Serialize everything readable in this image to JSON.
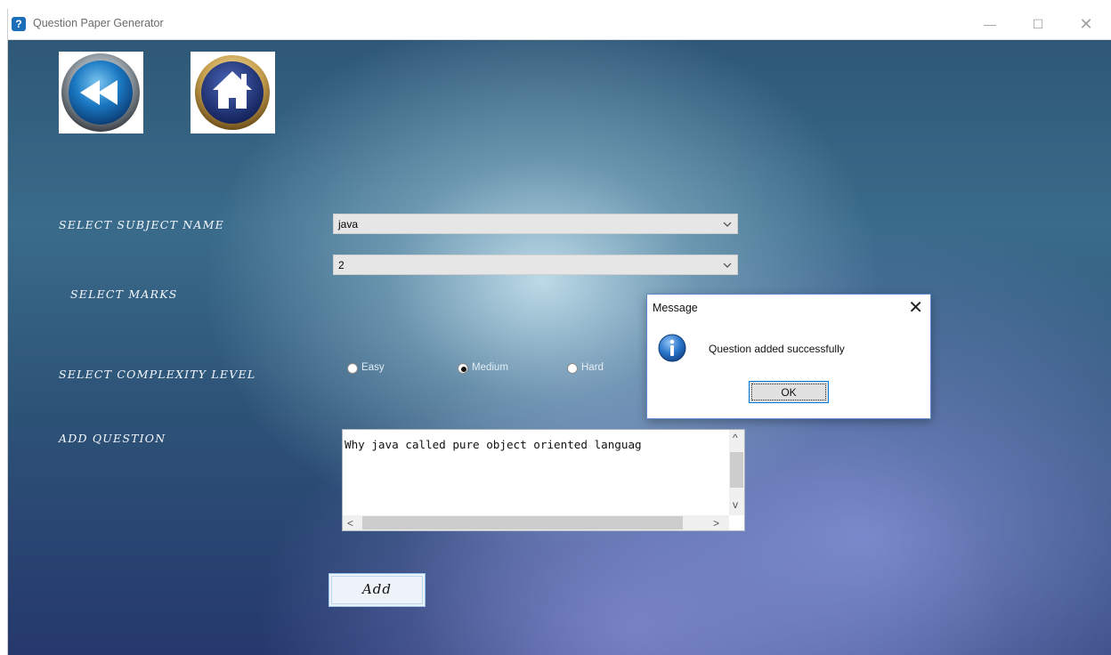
{
  "window": {
    "title": "Question Paper Generator",
    "min_glyph": "—",
    "max_glyph": "☐",
    "close_glyph": "✕"
  },
  "nav": {
    "back_icon": "rewind-back-icon",
    "home_icon": "home-icon"
  },
  "labels": {
    "subject": "SELECT SUBJECT NAME",
    "marks": "SELECT MARKS",
    "complexity": "SELECT COMPLEXITY LEVEL",
    "question": "ADD QUESTION"
  },
  "subject_select": {
    "value": "java"
  },
  "marks_select": {
    "value": "2"
  },
  "complexity": {
    "options": [
      "Easy",
      "Medium",
      "Hard"
    ],
    "selected": "Medium"
  },
  "question_input": {
    "value": "Why java called pure object oriented languag"
  },
  "scroll_glyphs": {
    "up": "^",
    "down": "v",
    "left": "<",
    "right": ">"
  },
  "add_button": {
    "label": "Add"
  },
  "dialog": {
    "title": "Message",
    "close_glyph": "✕",
    "message": "Question added successfully",
    "ok_label": "OK",
    "icon": "info-icon"
  },
  "colors": {
    "accent_blue": "#0078d7",
    "label_text": "#f5f8ff",
    "background_dark": "#2d5377",
    "background_light": "#c4e1ed"
  }
}
